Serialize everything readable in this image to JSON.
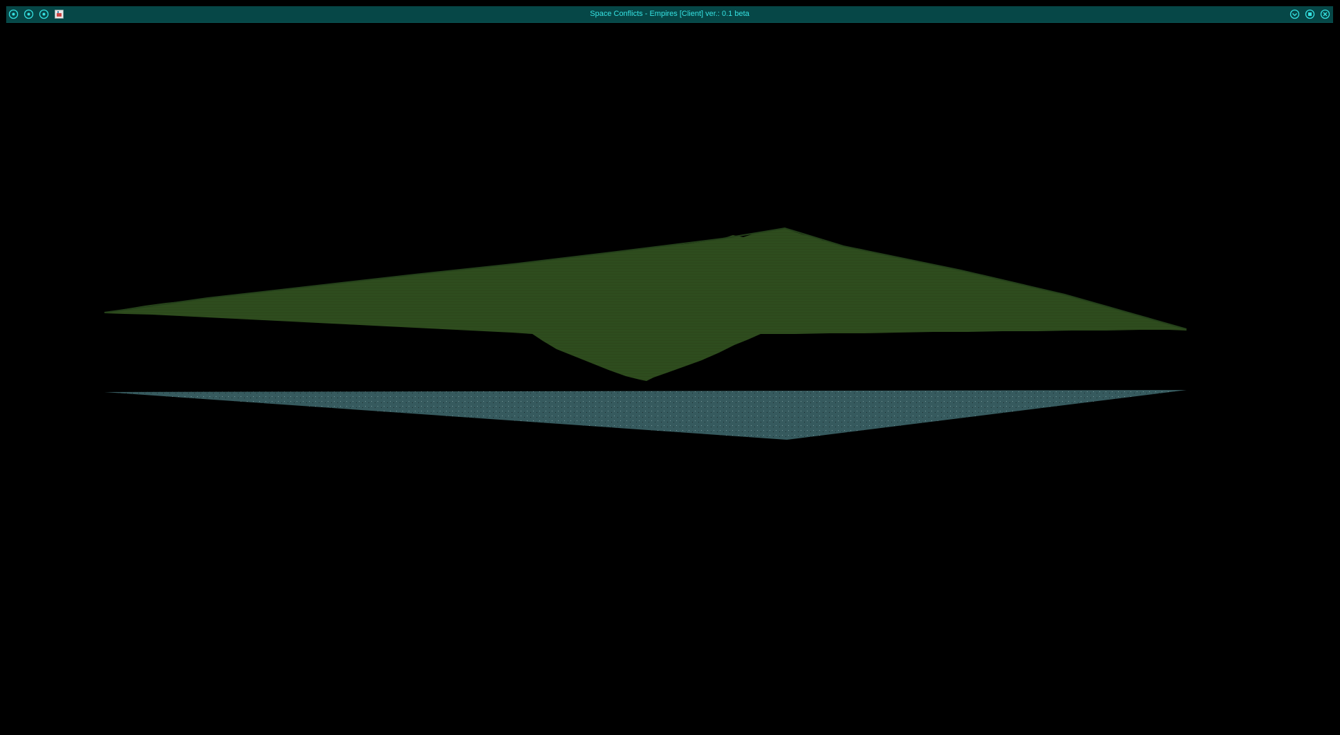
{
  "window": {
    "title": "Space Conflicts - Empires [Client] ver.: 0.1 beta"
  },
  "titlebar": {
    "left_icons": [
      "circle-menu-icon",
      "circle-menu-icon",
      "circle-menu-icon",
      "java-app-icon"
    ],
    "right_icons": [
      "minimize-icon",
      "maximize-icon",
      "close-icon"
    ]
  },
  "scene": {
    "terrain_color": "#2f4a1f",
    "water_color": "#365a5e",
    "background_color": "#000000",
    "accent_color": "#36e3e3",
    "titlebar_color": "#064747"
  }
}
